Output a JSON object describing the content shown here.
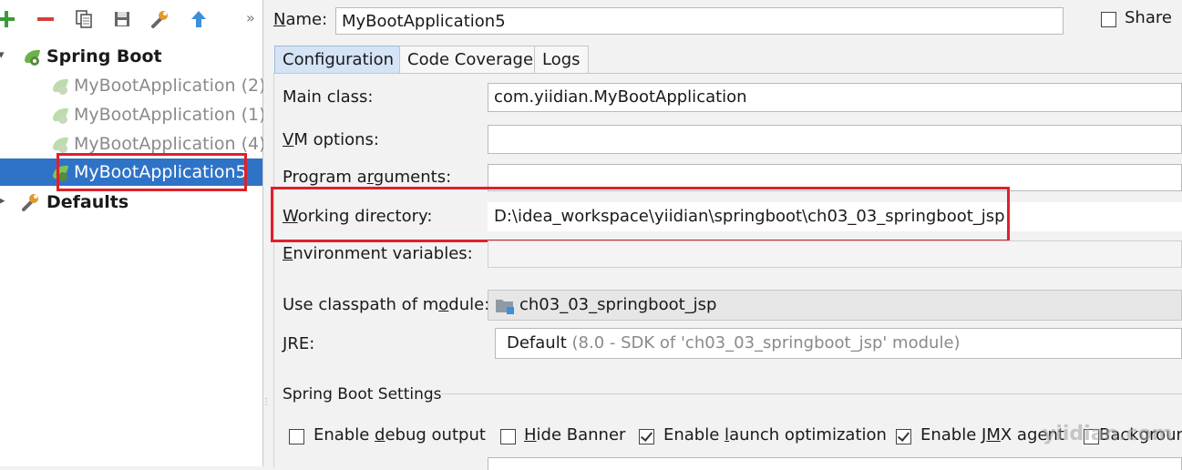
{
  "toolbar": {
    "add_icon": "plus-icon",
    "remove_icon": "minus-icon",
    "copy_icon": "copy-icon",
    "save_icon": "save-icon",
    "edit_defaults_icon": "wrench-icon",
    "move_up_icon": "arrow-up-icon",
    "more_label": "»"
  },
  "tree": {
    "group_label": "Spring Boot",
    "items": [
      {
        "label": "MyBootApplication (2)"
      },
      {
        "label": "MyBootApplication (1)"
      },
      {
        "label": "MyBootApplication (4)"
      },
      {
        "label": "MyBootApplication5"
      }
    ],
    "defaults_label": "Defaults"
  },
  "header": {
    "name_label_n": "N",
    "name_label_rest": "ame:",
    "name_value": "MyBootApplication5",
    "share_label": "Share"
  },
  "tabs": [
    {
      "label": "Configuration"
    },
    {
      "label": "Code Coverage"
    },
    {
      "label": "Logs"
    }
  ],
  "form": {
    "main_class_label": "Main class:",
    "main_class_value": "com.yiidian.MyBootApplication",
    "vm_options_label_v": "V",
    "vm_options_label_rest": "M options:",
    "vm_options_value": "",
    "program_args_label_a": "Program a",
    "program_args_label_u": "r",
    "program_args_label_b": "guments:",
    "program_args_value": "",
    "working_dir_label_w": "W",
    "working_dir_label_rest": "orking directory:",
    "working_dir_value": "D:\\idea_workspace\\yiidian\\springboot\\ch03_03_springboot_jsp",
    "env_vars_label_e": "E",
    "env_vars_label_rest": "nvironment variables:",
    "env_vars_value": "",
    "classpath_label_a": "Use classpath of m",
    "classpath_label_u": "o",
    "classpath_label_b": "dule:",
    "classpath_value": "ch03_03_springboot_jsp",
    "jre_label_j": "J",
    "jre_label_rest": "RE:",
    "jre_value": "Default",
    "jre_detail": " (8.0 - SDK of 'ch03_03_springboot_jsp' module)"
  },
  "spring_boot_settings": {
    "title": "Spring Boot Settings",
    "options": [
      {
        "a": "Enable ",
        "u": "d",
        "b": "ebug output",
        "checked": false
      },
      {
        "a": "",
        "u": "H",
        "b": "ide Banner",
        "checked": false
      },
      {
        "a": "Enable ",
        "u": "l",
        "b": "aunch optimization",
        "checked": true
      },
      {
        "a": "Enable J",
        "u": "M",
        "b": "X agent",
        "checked": true
      }
    ],
    "partial_option": "Backgroun"
  },
  "watermark": "yiidian.com",
  "colors": {
    "selection": "#2f73c7",
    "highlight_box": "#e0202a",
    "add_icon": "#3a9a3a",
    "remove_icon": "#d2403a",
    "active_tab": "#d4e3f5"
  }
}
